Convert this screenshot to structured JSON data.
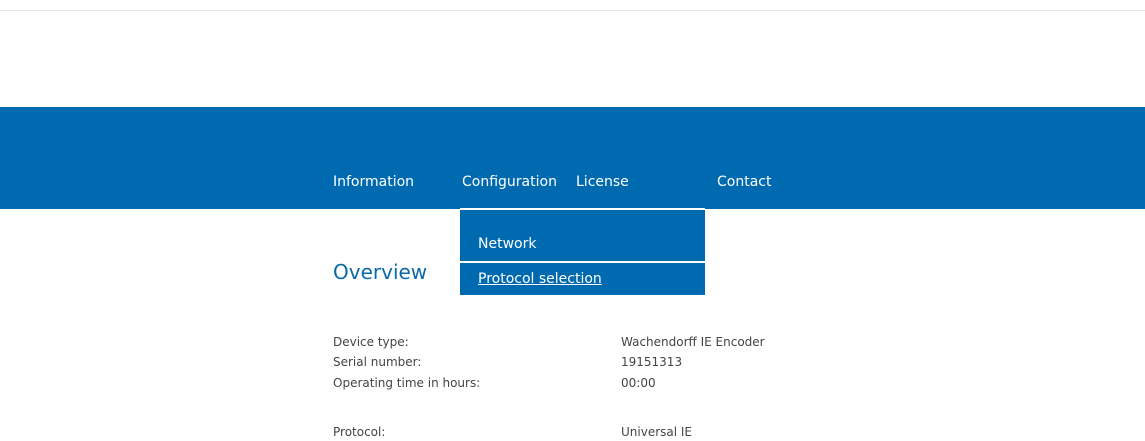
{
  "nav": {
    "items": [
      {
        "label": "Information"
      },
      {
        "label": "Configuration"
      },
      {
        "label": "License"
      },
      {
        "label": "Contact"
      }
    ],
    "dropdown": {
      "items": [
        {
          "label": "Network"
        },
        {
          "label": "Protocol selection"
        }
      ]
    }
  },
  "main": {
    "title": "Overview",
    "info": [
      {
        "label": "Device type:",
        "value": "Wachendorff IE Encoder"
      },
      {
        "label": "Serial number:",
        "value": "19151313"
      },
      {
        "label": "Operating time in hours:",
        "value": "00:00"
      },
      {
        "label": "Protocol:",
        "value": "Universal IE"
      }
    ]
  },
  "colors": {
    "brand_blue": "#006ab0",
    "title_blue": "#0a6aa8",
    "text": "#444444"
  }
}
